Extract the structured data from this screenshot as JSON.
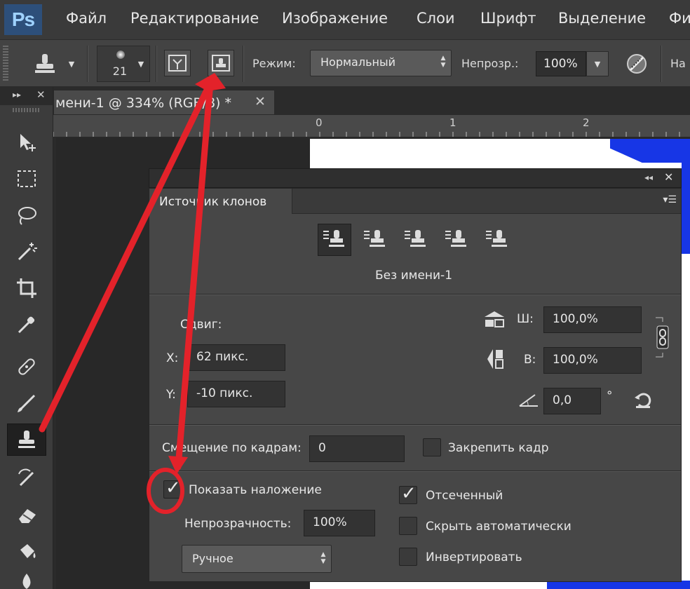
{
  "menubar": {
    "logo": "Ps",
    "items": [
      "Файл",
      "Редактирование",
      "Изображение",
      "Слои",
      "Шрифт",
      "Выделение",
      "Фи"
    ]
  },
  "options": {
    "brush_size": "21",
    "mode_label": "Режим:",
    "mode_value": "Нормальный",
    "opacity_label": "Непрозр.:",
    "opacity_value": "100%",
    "trailing_label": "На"
  },
  "document": {
    "tab_title": "мени-1 @ 334% (RGB/8) *",
    "ruler_labels": [
      "0",
      "1",
      "2"
    ]
  },
  "clone_panel": {
    "title": "Источник клонов",
    "source_name": "Без имени-1",
    "offset_label": "Сдвиг:",
    "x_label": "X:",
    "x_value": "62 пикс.",
    "y_label": "Y:",
    "y_value": "-10 пикс.",
    "w_label": "Ш:",
    "w_value": "100,0%",
    "h_label": "В:",
    "h_value": "100,0%",
    "angle_value": "0,0",
    "degree_sign": "°",
    "frame_offset_label": "Смещение по кадрам:",
    "frame_offset_value": "0",
    "lock_frame_label": "Закрепить кадр",
    "lock_frame_checked": false,
    "show_overlay_label": "Показать наложение",
    "show_overlay_checked": true,
    "overlay_opacity_label": "Непрозрачность:",
    "overlay_opacity_value": "100%",
    "blend_mode_value": "Ручное",
    "clipped_label": "Отсеченный",
    "clipped_checked": true,
    "auto_hide_label": "Скрыть автоматически",
    "auto_hide_checked": false,
    "invert_label": "Инвертировать",
    "invert_checked": false
  },
  "colors": {
    "annotation": "#e3222a",
    "canvas_blue": "#1736e6"
  }
}
